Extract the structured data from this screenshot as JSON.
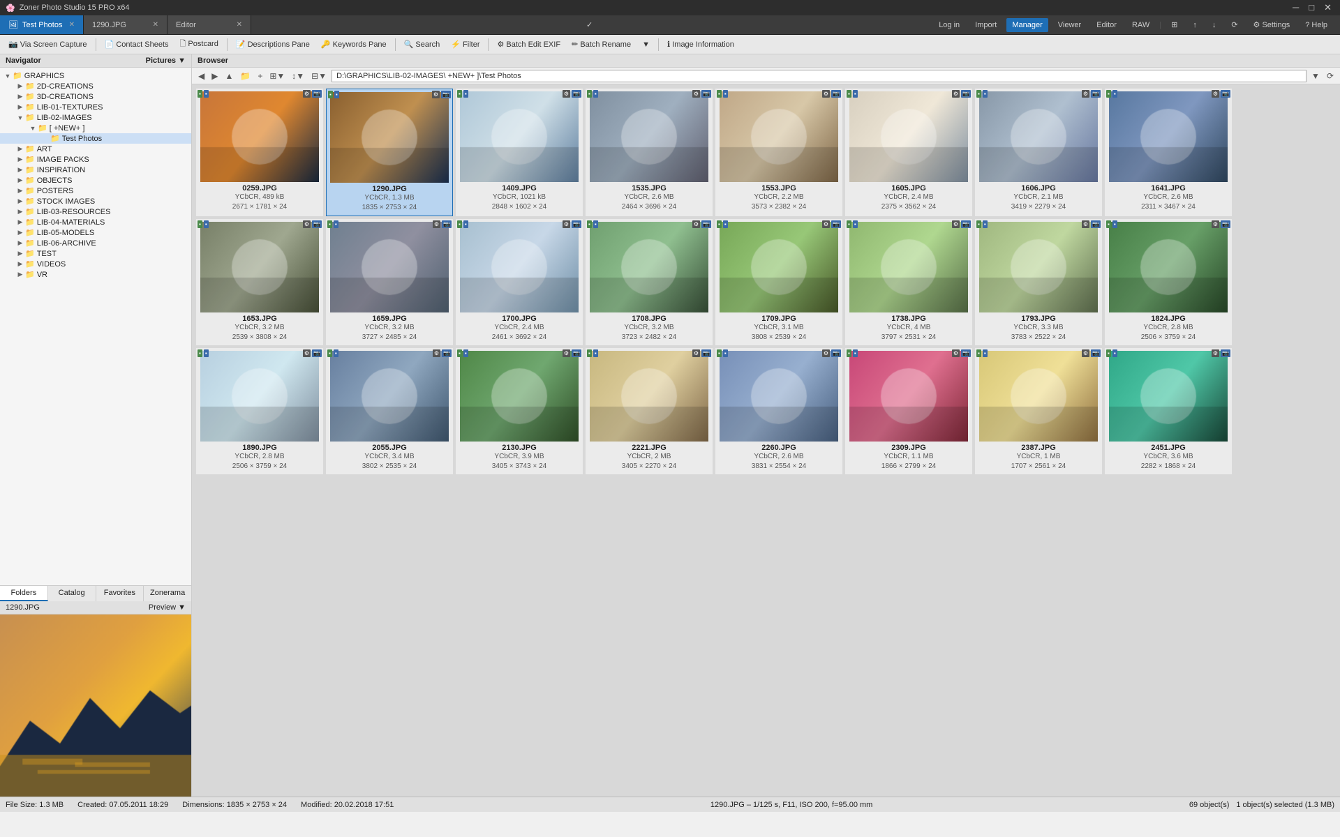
{
  "app": {
    "title": "Zoner Photo Studio 15 PRO x64",
    "titlebar_controls": [
      "─",
      "□",
      "✕"
    ]
  },
  "tabs": [
    {
      "label": "Test Photos",
      "active": true,
      "closable": true
    },
    {
      "label": "1290.JPG",
      "active": false,
      "closable": true
    },
    {
      "label": "Editor",
      "active": false,
      "closable": true
    }
  ],
  "toolbar": {
    "buttons": [
      "Log in",
      "Import",
      "Manager",
      "Viewer",
      "Editor",
      "RAW"
    ],
    "active": "Manager",
    "right_buttons": [
      "⊞",
      "↑",
      "↓",
      "⟳",
      "Settings",
      "Help"
    ]
  },
  "second_toolbar": {
    "buttons": [
      {
        "label": "Via Screen Capture",
        "icon": "camera"
      },
      {
        "label": "Contact Sheets",
        "icon": "sheet"
      },
      {
        "label": "Postcard",
        "icon": "postcard"
      },
      {
        "label": "Descriptions Pane",
        "icon": "description"
      },
      {
        "label": "Keywords Pane",
        "icon": "keywords"
      },
      {
        "label": "Search",
        "icon": "search"
      },
      {
        "label": "Filter",
        "icon": "filter"
      },
      {
        "label": "Batch Edit EXIF",
        "icon": "batch"
      },
      {
        "label": "Batch Rename",
        "icon": "rename"
      },
      {
        "label": "Image Information",
        "icon": "info"
      }
    ]
  },
  "navigator": {
    "header": "Navigator",
    "dropdown": "Pictures"
  },
  "browser_header": "Browser",
  "address": "D:\\GRAPHICS\\LIB-02-IMAGES\\ +NEW+ ]\\Test Photos",
  "tree": [
    {
      "label": "GRAPHICS",
      "level": 0,
      "expanded": true,
      "is_folder": true
    },
    {
      "label": "2D-CREATIONS",
      "level": 1,
      "expanded": false,
      "is_folder": true
    },
    {
      "label": "3D-CREATIONS",
      "level": 1,
      "expanded": false,
      "is_folder": true
    },
    {
      "label": "LIB-01-TEXTURES",
      "level": 1,
      "expanded": false,
      "is_folder": true
    },
    {
      "label": "LIB-02-IMAGES",
      "level": 1,
      "expanded": true,
      "is_folder": true
    },
    {
      "label": "[ +NEW+ ]",
      "level": 2,
      "expanded": true,
      "is_folder": true
    },
    {
      "label": "Test Photos",
      "level": 3,
      "expanded": false,
      "is_folder": true,
      "selected": true
    },
    {
      "label": "ART",
      "level": 1,
      "expanded": false,
      "is_folder": true
    },
    {
      "label": "IMAGE PACKS",
      "level": 1,
      "expanded": false,
      "is_folder": true
    },
    {
      "label": "INSPIRATION",
      "level": 1,
      "expanded": false,
      "is_folder": true
    },
    {
      "label": "OBJECTS",
      "level": 1,
      "expanded": false,
      "is_folder": true
    },
    {
      "label": "POSTERS",
      "level": 1,
      "expanded": false,
      "is_folder": true
    },
    {
      "label": "STOCK IMAGES",
      "level": 1,
      "expanded": false,
      "is_folder": true
    },
    {
      "label": "LIB-03-RESOURCES",
      "level": 1,
      "expanded": false,
      "is_folder": true
    },
    {
      "label": "LIB-04-MATERIALS",
      "level": 1,
      "expanded": false,
      "is_folder": true
    },
    {
      "label": "LIB-05-MODELS",
      "level": 1,
      "expanded": false,
      "is_folder": true
    },
    {
      "label": "LIB-06-ARCHIVE",
      "level": 1,
      "expanded": false,
      "is_folder": true
    },
    {
      "label": "TEST",
      "level": 1,
      "expanded": false,
      "is_folder": true
    },
    {
      "label": "VIDEOS",
      "level": 1,
      "expanded": false,
      "is_folder": true
    },
    {
      "label": "VR",
      "level": 1,
      "expanded": false,
      "is_folder": true
    }
  ],
  "left_tabs": [
    "Folders",
    "Catalog",
    "Favorites",
    "Zonerama"
  ],
  "preview": {
    "filename": "1290.JPG",
    "label": "Preview"
  },
  "thumbnails": [
    {
      "name": "0259.JPG",
      "color_space": "YCbCR",
      "size": "489 kB",
      "dims": "2671 × 1781 × 24",
      "selected": false,
      "bg": "#c8763a"
    },
    {
      "name": "1290.JPG",
      "color_space": "YCbCR",
      "size": "1.3 MB",
      "dims": "1835 × 2753 × 24",
      "selected": true,
      "bg": "#8a6030"
    },
    {
      "name": "1409.JPG",
      "color_space": "YCbCR",
      "size": "1021 kB",
      "dims": "2848 × 1602 × 24",
      "selected": false,
      "bg": "#b0c8d8"
    },
    {
      "name": "1535.JPG",
      "color_space": "YCbCR",
      "size": "2.6 MB",
      "dims": "2464 × 3696 × 24",
      "selected": false,
      "bg": "#8090a0"
    },
    {
      "name": "1553.JPG",
      "color_space": "YCbCR",
      "size": "2.2 MB",
      "dims": "3573 × 2382 × 24",
      "selected": false,
      "bg": "#c0a888"
    },
    {
      "name": "1605.JPG",
      "color_space": "YCbCR",
      "size": "2.4 MB",
      "dims": "2375 × 3562 × 24",
      "selected": false,
      "bg": "#d8d0c0"
    },
    {
      "name": "1606.JPG",
      "color_space": "YCbCR",
      "size": "2.1 MB",
      "dims": "3419 × 2279 × 24",
      "selected": false,
      "bg": "#8898a8"
    },
    {
      "name": "1641.JPG",
      "color_space": "YCbCR",
      "size": "2.6 MB",
      "dims": "2311 × 3467 × 24",
      "selected": false,
      "bg": "#5878a0"
    },
    {
      "name": "1653.JPG",
      "color_space": "YCbCR",
      "size": "3.2 MB",
      "dims": "2539 × 3808 × 24",
      "selected": false,
      "bg": "#788068"
    },
    {
      "name": "1659.JPG",
      "color_space": "YCbCR",
      "size": "3.2 MB",
      "dims": "3727 × 2485 × 24",
      "selected": false,
      "bg": "#708090"
    },
    {
      "name": "1700.JPG",
      "color_space": "YCbCR",
      "size": "2.4 MB",
      "dims": "2461 × 3692 × 24",
      "selected": false,
      "bg": "#a8c0d0"
    },
    {
      "name": "1708.JPG",
      "color_space": "YCbCR",
      "size": "3.2 MB",
      "dims": "3723 × 2482 × 24",
      "selected": false,
      "bg": "#70a070"
    },
    {
      "name": "1709.JPG",
      "color_space": "YCbCR",
      "size": "3.1 MB",
      "dims": "3808 × 2539 × 24",
      "selected": false,
      "bg": "#78a858"
    },
    {
      "name": "1738.JPG",
      "color_space": "YCbCR",
      "size": "4 MB",
      "dims": "3797 × 2531 × 24",
      "selected": false,
      "bg": "#90b870"
    },
    {
      "name": "1793.JPG",
      "color_space": "YCbCR",
      "size": "3.3 MB",
      "dims": "3783 × 2522 × 24",
      "selected": false,
      "bg": "#a0b880"
    },
    {
      "name": "1824.JPG",
      "color_space": "YCbCR",
      "size": "2.8 MB",
      "dims": "2506 × 3759 × 24",
      "selected": false,
      "bg": "#488048"
    },
    {
      "name": "1890.JPG",
      "color_space": "YCbCR",
      "size": "2.8 MB",
      "dims": "2506 × 3759 × 24",
      "selected": false,
      "bg": "#b8d0e0"
    },
    {
      "name": "2055.JPG",
      "color_space": "YCbCR",
      "size": "3.4 MB",
      "dims": "3802 × 2535 × 24",
      "selected": false,
      "bg": "#6880a0"
    },
    {
      "name": "2130.JPG",
      "color_space": "YCbCR",
      "size": "3.9 MB",
      "dims": "3405 × 3743 × 24",
      "selected": false,
      "bg": "#508848"
    },
    {
      "name": "2221.JPG",
      "color_space": "YCbCR",
      "size": "2 MB",
      "dims": "3405 × 2270 × 24",
      "selected": false,
      "bg": "#c8b880"
    },
    {
      "name": "2260.JPG",
      "color_space": "YCbCR",
      "size": "2.6 MB",
      "dims": "3831 × 2554 × 24",
      "selected": false,
      "bg": "#7890b8"
    },
    {
      "name": "2309.JPG",
      "color_space": "YCbCR",
      "size": "1.1 MB",
      "dims": "1866 × 2799 × 24",
      "selected": false,
      "bg": "#c84878"
    },
    {
      "name": "2387.JPG",
      "color_space": "YCbCR",
      "size": "1 MB",
      "dims": "1707 × 2561 × 24",
      "selected": false,
      "bg": "#d8c878"
    },
    {
      "name": "2451.JPG",
      "color_space": "YCbCR",
      "size": "3.6 MB",
      "dims": "2282 × 1868 × 24",
      "selected": false,
      "bg": "#30a888"
    }
  ],
  "statusbar": {
    "file_size": "File Size: 1.3 MB",
    "created": "Created: 07.05.2011 18:29",
    "dimensions": "Dimensions: 1835 × 2753 × 24",
    "modified": "Modified: 20.02.2018 17:51",
    "exif": "1290.JPG – 1/125 s, F11, ISO 200, f=95.00 mm",
    "objects": "69 object(s)",
    "selected": "1 object(s) selected (1.3 MB)"
  }
}
